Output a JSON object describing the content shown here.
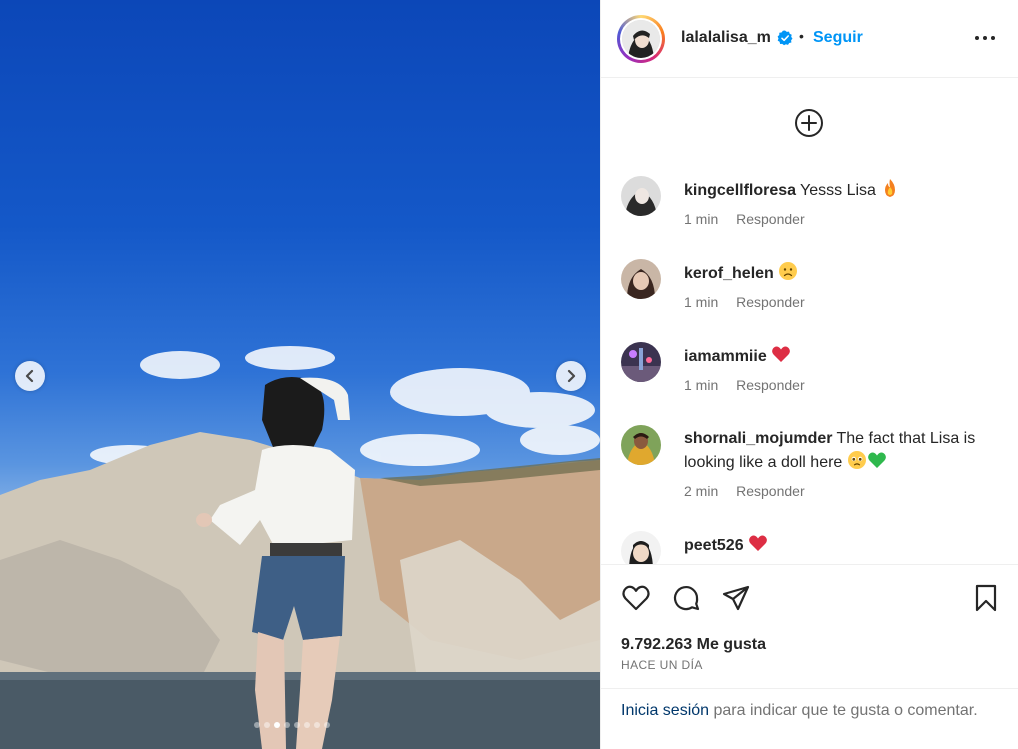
{
  "post": {
    "username": "lalalalisa_m",
    "separator": "•",
    "follow_label": "Seguir",
    "photo_count": 8,
    "active_photo_index": 3
  },
  "comments": [
    {
      "user": "kingcellfloresa",
      "text": "Yesss Lisa",
      "emojis": [
        "fire-emoji"
      ],
      "time": "1 min",
      "reply": "Responder"
    },
    {
      "user": "kerof_helen",
      "text": "",
      "emojis": [
        "sad-face-emoji"
      ],
      "time": "1 min",
      "reply": "Responder"
    },
    {
      "user": "iamammiie",
      "text": "",
      "emojis": [
        "red-heart-emoji"
      ],
      "time": "1 min",
      "reply": "Responder"
    },
    {
      "user": "shornali_mojumder",
      "text": "The fact that Lisa is looking like a doll here",
      "emojis": [
        "pleading-face-emoji",
        "green-heart-emoji"
      ],
      "time": "2 min",
      "reply": "Responder"
    },
    {
      "user": "peet526",
      "text": "",
      "emojis": [
        "red-heart-emoji"
      ],
      "time": "",
      "reply": ""
    }
  ],
  "stats": {
    "likes": "9.792.263 Me gusta",
    "time_ago": "HACE UN DÍA"
  },
  "login": {
    "link": "Inicia sesión",
    "rest": "para indicar que te gusta o comentar."
  },
  "colors": {
    "accent": "#0095f6",
    "text": "#262626",
    "muted": "#737373",
    "border": "#efefef",
    "heart": "#ed4956",
    "green_heart": "#2fb84d"
  }
}
